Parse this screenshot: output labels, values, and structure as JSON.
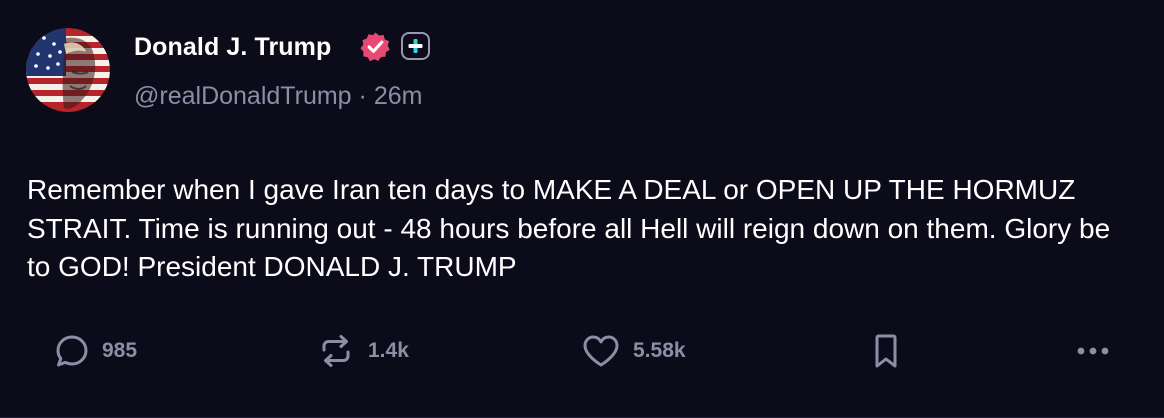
{
  "post": {
    "author": {
      "display_name": "Donald J. Trump",
      "handle": "@realDonaldTrump",
      "separator": "·",
      "time_ago": "26m",
      "verified_icon": "verified-badge-icon",
      "plus_icon": "plus-icon"
    },
    "text": "Remember when I gave Iran ten days to MAKE A DEAL or OPEN UP THE HORMUZ STRAIT. Time is running out - 48 hours before all Hell will reign down on them. Glory be to GOD! President DONALD J. TRUMP",
    "actions": {
      "reply": {
        "icon": "comment-icon",
        "count": "985"
      },
      "repost": {
        "icon": "repost-icon",
        "count": "1.4k"
      },
      "like": {
        "icon": "heart-icon",
        "count": "5.58k"
      },
      "bookmark": {
        "icon": "bookmark-icon"
      },
      "more": {
        "icon": "more-options-icon"
      }
    }
  },
  "colors": {
    "background": "#0c0b1a",
    "text_primary": "#ffffff",
    "text_secondary": "#8f8da6",
    "verified_pink": "#e64a73",
    "accent_cyan": "#36d1e0"
  }
}
